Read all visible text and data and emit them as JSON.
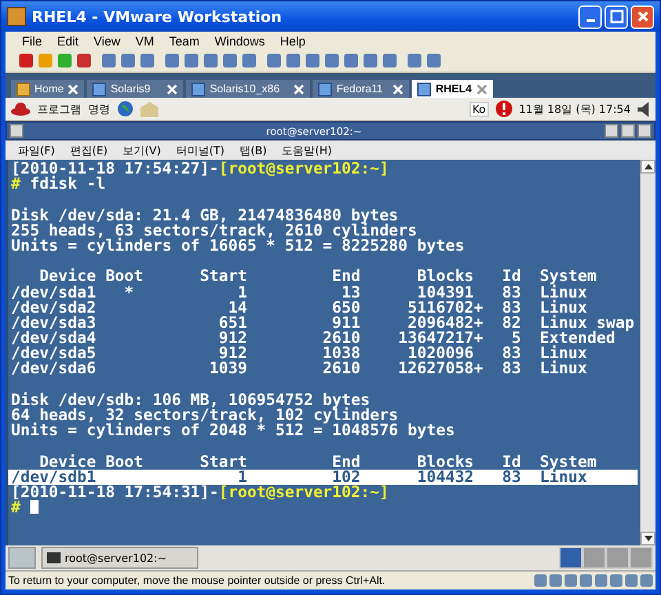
{
  "window": {
    "title": "RHEL4 - VMware Workstation"
  },
  "menu": [
    "File",
    "Edit",
    "View",
    "VM",
    "Team",
    "Windows",
    "Help"
  ],
  "vm_tabs": [
    {
      "label": "Home",
      "selected": false
    },
    {
      "label": "Solaris9",
      "selected": false
    },
    {
      "label": "Solaris10_x86",
      "selected": false
    },
    {
      "label": "Fedora11",
      "selected": false
    },
    {
      "label": "RHEL4",
      "selected": true
    }
  ],
  "guest_panel": {
    "menus": [
      "프로그램",
      "명령"
    ],
    "input_method": "Ko",
    "clock": "11월 18일 (목) 17:54"
  },
  "terminal": {
    "title": "root@server102:~",
    "menu": [
      "파일(F)",
      "편집(E)",
      "보기(V)",
      "터미널(T)",
      "탭(B)",
      "도움말(H)"
    ],
    "lines": [
      {
        "kind": "prompt",
        "time": "[2010-11-18 17:54:27]-",
        "host": "[root@server102:~]"
      },
      {
        "kind": "command",
        "sign": "#",
        "text": "fdisk -l"
      },
      {
        "kind": "blank"
      },
      {
        "kind": "output",
        "text": "Disk /dev/sda: 21.4 GB, 21474836480 bytes",
        "highlighted": false
      },
      {
        "kind": "output",
        "text": "255 heads, 63 sectors/track, 2610 cylinders",
        "highlighted": false
      },
      {
        "kind": "output",
        "text": "Units = cylinders of 16065 * 512 = 8225280 bytes",
        "highlighted": false
      },
      {
        "kind": "blank"
      },
      {
        "kind": "output",
        "text": "   Device Boot      Start         End      Blocks   Id  System",
        "highlighted": false
      },
      {
        "kind": "output",
        "text": "/dev/sda1   *           1          13      104391   83  Linux",
        "highlighted": false
      },
      {
        "kind": "output",
        "text": "/dev/sda2              14         650     5116702+  83  Linux",
        "highlighted": false
      },
      {
        "kind": "output",
        "text": "/dev/sda3             651         911     2096482+  82  Linux swap",
        "highlighted": false
      },
      {
        "kind": "output",
        "text": "/dev/sda4             912        2610    13647217+   5  Extended",
        "highlighted": false
      },
      {
        "kind": "output",
        "text": "/dev/sda5             912        1038     1020096   83  Linux",
        "highlighted": false
      },
      {
        "kind": "output",
        "text": "/dev/sda6            1039        2610    12627058+  83  Linux",
        "highlighted": false
      },
      {
        "kind": "blank"
      },
      {
        "kind": "output",
        "text": "Disk /dev/sdb: 106 MB, 106954752 bytes",
        "highlighted": false
      },
      {
        "kind": "output",
        "text": "64 heads, 32 sectors/track, 102 cylinders",
        "highlighted": false
      },
      {
        "kind": "output",
        "text": "Units = cylinders of 2048 * 512 = 1048576 bytes",
        "highlighted": false
      },
      {
        "kind": "blank"
      },
      {
        "kind": "output",
        "text": "   Device Boot      Start         End      Blocks   Id  System",
        "highlighted": false
      },
      {
        "kind": "output",
        "text": "/dev/sdb1               1         102      104432   83  Linux",
        "highlighted": true
      },
      {
        "kind": "prompt",
        "time": "[2010-11-18 17:54:31]-",
        "host": "[root@server102:~]"
      },
      {
        "kind": "command",
        "sign": "#",
        "cursor": true
      }
    ]
  },
  "taskbar": {
    "task": "root@server102:~",
    "workspaces": [
      {
        "selected": true
      },
      {
        "selected": false
      },
      {
        "selected": false
      },
      {
        "selected": false
      }
    ]
  },
  "status_bar": "To return to your computer, move the mouse pointer outside or press Ctrl+Alt."
}
